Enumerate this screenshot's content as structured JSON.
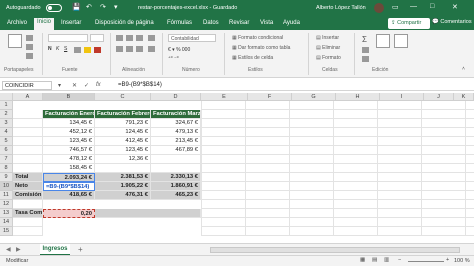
{
  "title_bar": {
    "autosave_label": "Autoguardado",
    "toggle_state": "Off",
    "document_title": "restar-porcentajes-excel.xlsx  -  Guardado",
    "user_name": "Alberto López Tallón"
  },
  "menu": {
    "items": [
      "Archivo",
      "Inicio",
      "Insertar",
      "Disposición de página",
      "Fórmulas",
      "Datos",
      "Revisar",
      "Vista",
      "Ayuda"
    ],
    "active": "Inicio",
    "share_label": "Compartir",
    "comments_label": "Comentarios"
  },
  "ribbon": {
    "groups": [
      "Portapapeles",
      "Fuente",
      "Alineación",
      "Número",
      "Estilos",
      "Celdas",
      "Edición"
    ],
    "styles": [
      "Formato condicional",
      "Dar formato como tabla",
      "Estilos de celda"
    ],
    "cells": [
      "Insertar",
      "Eliminar",
      "Formato"
    ],
    "number_format": "Contabilidad"
  },
  "formula_bar": {
    "name_box": "COINCIDIR",
    "formula": "=B9-(B9*$B$14)"
  },
  "grid": {
    "columns": [
      "A",
      "B",
      "C",
      "D",
      "E",
      "F",
      "G",
      "H",
      "I",
      "J",
      "K"
    ],
    "rows": [
      "1",
      "2",
      "3",
      "4",
      "5",
      "6",
      "7",
      "8",
      "9",
      "10",
      "11",
      "12",
      "13",
      "14",
      "15"
    ],
    "headers": {
      "B": "Facturación Enero",
      "C": "Facturación Febrero",
      "D": "Facturación Marzo"
    },
    "data": {
      "B": [
        "134,45 €",
        "452,12 €",
        "123,45 €",
        "746,57 €",
        "478,12 €",
        "158,45 €",
        ""
      ],
      "C": [
        "791,23 €",
        "124,45 €",
        "412,45 €",
        "123,45 €",
        "12,36 €",
        "",
        ""
      ],
      "D": [
        "324,67 €",
        "479,13 €",
        "213,45 €",
        "467,89 €",
        "",
        "",
        ""
      ]
    },
    "totals_label": "Total",
    "neto_label": "Neto",
    "comision_label": "Comisión",
    "tasa_label": "Tasa Com.",
    "totals": [
      "2.093,24 €",
      "2.381,53 €",
      "2.330,13 €"
    ],
    "neto": [
      "=B9-(B9*$B$14)",
      "1.905,22 €",
      "1.860,91 €"
    ],
    "comision": [
      "418,65 €",
      "476,31 €",
      "465,23 €"
    ],
    "tasa": "0,20"
  },
  "sheet": {
    "tab_name": "Ingresos",
    "add_sheet": "+"
  },
  "status": {
    "mode": "Modificar",
    "zoom": "100 %"
  },
  "colors": {
    "accent": "#217346",
    "header_fill": "#2e6b3a",
    "total_fill": "#d0d0d0",
    "input_fill": "#f4cccc"
  }
}
